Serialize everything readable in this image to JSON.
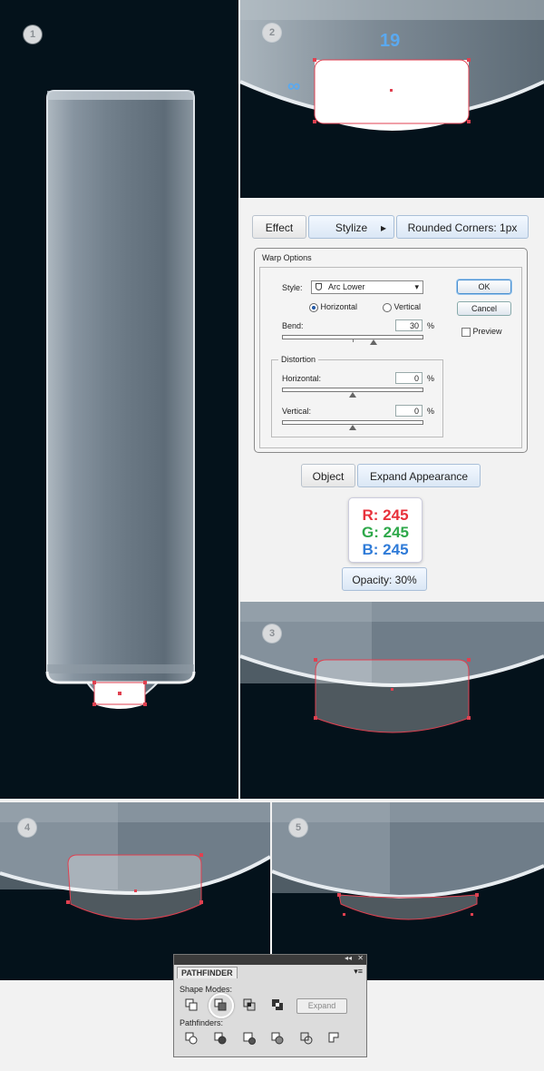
{
  "steps": [
    "1",
    "2",
    "3",
    "4",
    "5"
  ],
  "panel2": {
    "number_label": "19",
    "symbol": "∞"
  },
  "effect_menu": {
    "effect": "Effect",
    "stylize": "Stylize",
    "arrow": "▸",
    "rounded_corners": "Rounded Corners: 1px"
  },
  "warp_dialog": {
    "title": "Warp Options",
    "style_label": "Style:",
    "style_value": "Arc Lower",
    "horizontal": "Horizontal",
    "vertical": "Vertical",
    "orientation_selected": "Horizontal",
    "bend_label": "Bend:",
    "bend_value": "30",
    "percent": "%",
    "distortion_label": "Distortion",
    "dist_horizontal_label": "Horizontal:",
    "dist_horizontal_value": "0",
    "dist_vertical_label": "Vertical:",
    "dist_vertical_value": "0",
    "ok": "OK",
    "cancel": "Cancel",
    "preview": "Preview",
    "bend_slider_fraction": 0.65,
    "h_slider_fraction": 0.5,
    "v_slider_fraction": 0.5
  },
  "object_menu": {
    "object": "Object",
    "expand_appearance": "Expand Appearance"
  },
  "color": {
    "r_label": "R:",
    "r": "245",
    "g_label": "G:",
    "g": "245",
    "b_label": "B:",
    "b": "245",
    "r_color": "#e8313b",
    "g_color": "#2ea84a",
    "b_color": "#2f7bd8"
  },
  "opacity": "Opacity: 30%",
  "pathfinder": {
    "title": "PATHFINDER",
    "shape_modes": "Shape Modes:",
    "pathfinders": "Pathfinders:",
    "expand": "Expand",
    "collapse_icon": "◂◂",
    "close_icon": "✕",
    "menu_icon": "▾≡"
  },
  "colors": {
    "background_dark": "#04121b",
    "anchor_red": "#e04050",
    "highlight_blue": "#5aa9f0"
  }
}
